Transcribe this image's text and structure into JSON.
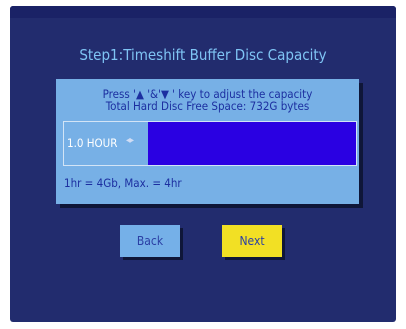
{
  "title": "Step1:Timeshift Buffer Disc Capacity",
  "dialog": {
    "instruction": "Press '▲ '&'▼ ' key to adjust the capacity",
    "free_space": "Total Hard Disc Free Space: 732G bytes",
    "capacity_value": "1.0 HOUR",
    "arrows_glyph": "◂▸",
    "info": "1hr = 4Gb, Max. = 4hr"
  },
  "buttons": {
    "back": "Back",
    "next": "Next"
  },
  "colors": {
    "background": "#222c6e",
    "dialog": "#77b0e6",
    "bar": "#2a00e2",
    "title": "#7fc4f4",
    "text": "#1c2fa0",
    "focus_button": "#f2e024"
  }
}
